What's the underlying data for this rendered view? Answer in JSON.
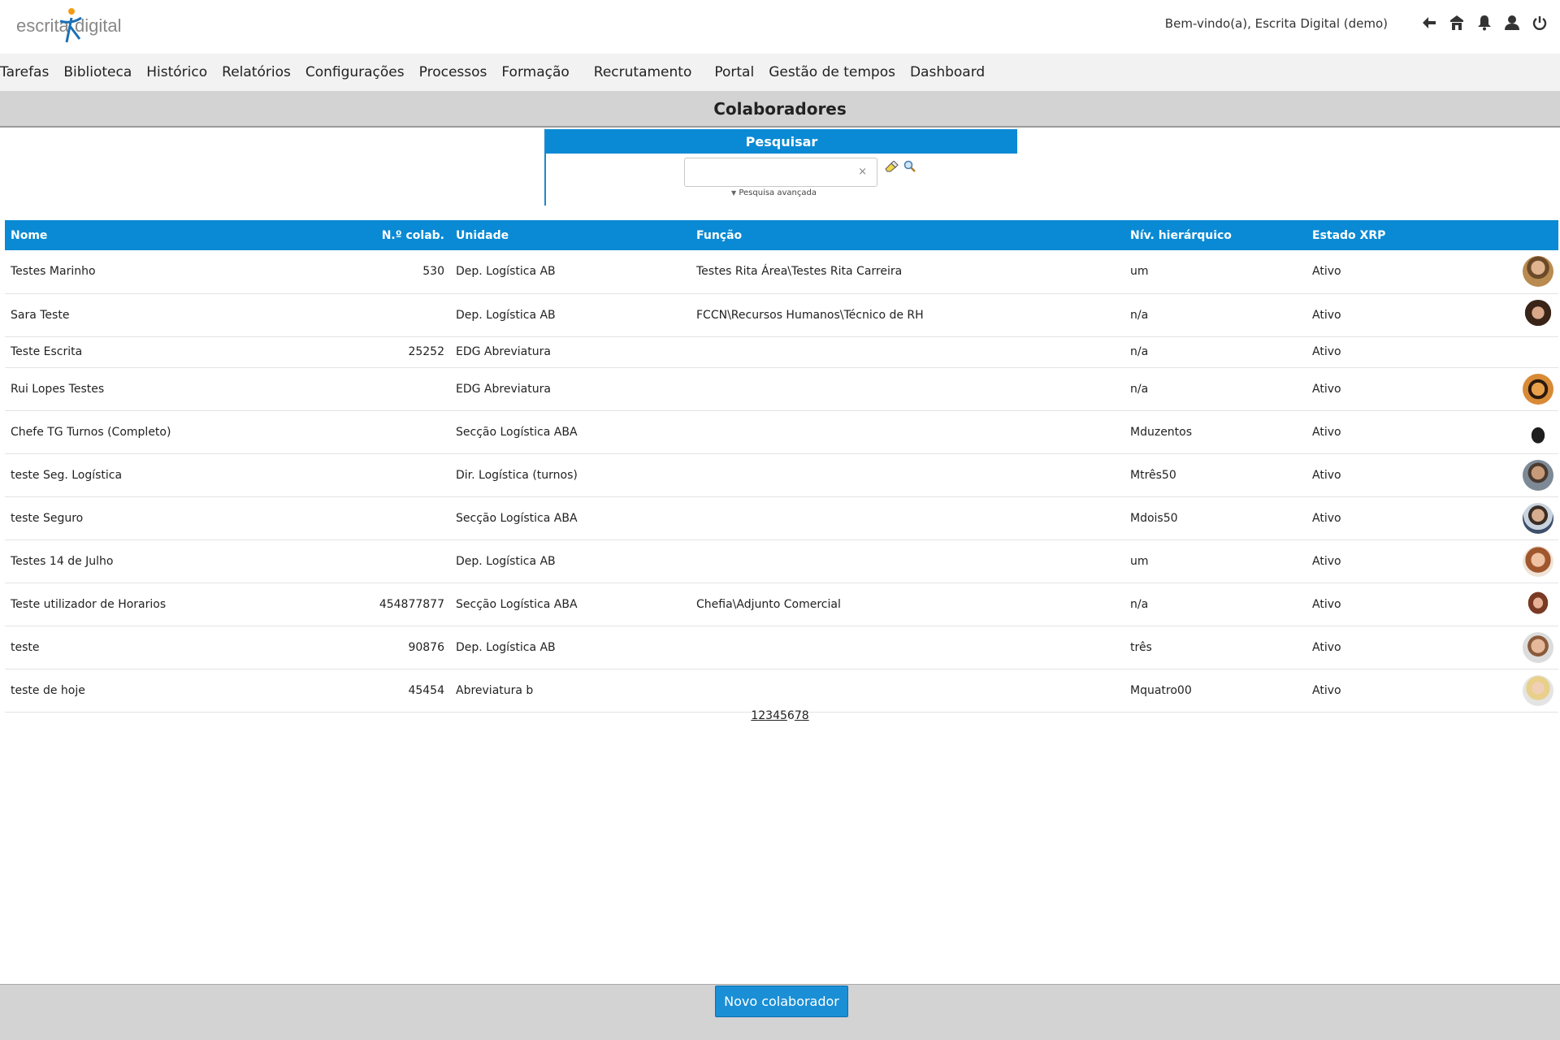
{
  "header": {
    "logo_part1": "escrita",
    "logo_part2": "digital",
    "welcome": "Bem-vindo(a), Escrita Digital (demo)",
    "icons": [
      "back-arrow-icon",
      "home-icon",
      "bell-icon",
      "user-icon",
      "power-icon"
    ]
  },
  "nav": {
    "items": [
      "Tarefas",
      "Biblioteca",
      "Histórico",
      "Relatórios",
      "Configurações",
      "Processos",
      "Formação",
      "Recrutamento",
      "Portal",
      "Gestão de tempos",
      "Dashboard"
    ]
  },
  "page": {
    "title": "Colaboradores"
  },
  "search": {
    "title": "Pesquisar",
    "value": "",
    "clear_glyph": "×",
    "advanced_label": "Pesquisa avançada"
  },
  "table": {
    "headers": [
      "Nome",
      "N.º colab.",
      "Unidade",
      "Função",
      "Nív. hierárquico",
      "Estado XRP"
    ],
    "rows": [
      {
        "nome": "Testes Marinho",
        "num": "530",
        "unidade": "Dep. Logística AB",
        "funcao": "Testes Rita Área\\Testes Rita Carreira",
        "nivel": "um",
        "estado": "Ativo",
        "avatar": "avatar-1"
      },
      {
        "nome": "Sara Teste",
        "num": "",
        "unidade": "Dep. Logística AB",
        "funcao": "FCCN\\Recursos Humanos\\Técnico de RH",
        "nivel": "n/a",
        "estado": "Ativo",
        "avatar": "avatar-2"
      },
      {
        "nome": "Teste Escrita",
        "num": "25252",
        "unidade": "EDG Abreviatura",
        "funcao": "",
        "nivel": "n/a",
        "estado": "Ativo",
        "avatar": ""
      },
      {
        "nome": "Rui Lopes Testes",
        "num": "",
        "unidade": "EDG Abreviatura",
        "funcao": "",
        "nivel": "n/a",
        "estado": "Ativo",
        "avatar": "avatar-3"
      },
      {
        "nome": "Chefe TG Turnos (Completo)",
        "num": "",
        "unidade": "Secção Logística ABA",
        "funcao": "",
        "nivel": "Mduzentos",
        "estado": "Ativo",
        "avatar": "avatar-4"
      },
      {
        "nome": "teste Seg. Logística",
        "num": "",
        "unidade": "Dir. Logística (turnos)",
        "funcao": "",
        "nivel": "Mtrês50",
        "estado": "Ativo",
        "avatar": "avatar-5"
      },
      {
        "nome": "teste Seguro",
        "num": "",
        "unidade": "Secção Logística ABA",
        "funcao": "",
        "nivel": "Mdois50",
        "estado": "Ativo",
        "avatar": "avatar-6"
      },
      {
        "nome": "Testes 14 de Julho",
        "num": "",
        "unidade": "Dep. Logística AB",
        "funcao": "",
        "nivel": "um",
        "estado": "Ativo",
        "avatar": "avatar-7"
      },
      {
        "nome": "Teste utilizador de Horarios",
        "num": "454877877",
        "unidade": "Secção Logística ABA",
        "funcao": "Chefia\\Adjunto Comercial",
        "nivel": "n/a",
        "estado": "Ativo",
        "avatar": "avatar-8"
      },
      {
        "nome": "teste",
        "num": "90876",
        "unidade": "Dep. Logística AB",
        "funcao": "",
        "nivel": "três",
        "estado": "Ativo",
        "avatar": "avatar-9"
      },
      {
        "nome": "teste de hoje",
        "num": "45454",
        "unidade": "Abreviatura b",
        "funcao": "",
        "nivel": "Mquatro00",
        "estado": "Ativo",
        "avatar": "avatar-10"
      }
    ]
  },
  "pagination": {
    "pages": [
      "1",
      "2",
      "3",
      "4",
      "5",
      "6",
      "7",
      "8"
    ],
    "current": "6"
  },
  "footer": {
    "new_button": "Novo colaborador"
  },
  "colors": {
    "accent": "#0a8ad4",
    "title_bar": "#d3d3d3",
    "nav_bg": "#f2f2f2"
  }
}
